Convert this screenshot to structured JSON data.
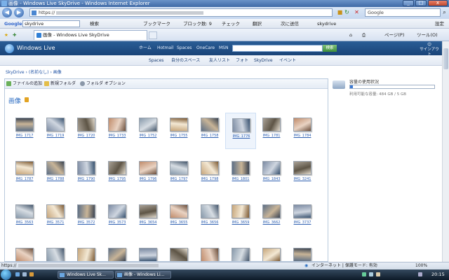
{
  "window": {
    "title": "画像 - Windows Live SkyDrive - Windows Internet Explorer"
  },
  "address": {
    "url_prefix": "https://",
    "search_placeholder": "Google"
  },
  "google_toolbar": {
    "label": "Google",
    "search_value": "skydrive",
    "search_btn": "検索",
    "bookmarks": "ブックマーク",
    "blocked": "ブロック数: 9",
    "check": "チェック",
    "translate": "翻訳",
    "send": "次に送信",
    "skydrive": "skydrive",
    "settings": "設定"
  },
  "tab": {
    "title": "画像 - Windows Live SkyDrive"
  },
  "commandbar": {
    "page": "ページ(P)",
    "tools": "ツール(O)"
  },
  "live_header": {
    "logo": "Windows Live",
    "links": [
      "ホーム",
      "Hotmail",
      "Spaces",
      "OneCare",
      "MSN"
    ],
    "search_btn": "検索",
    "signout": "サインアウト"
  },
  "nav": [
    "Spaces",
    "自分のスペース",
    "友人リスト",
    "フォト",
    "SkyDrive",
    "イベント"
  ],
  "breadcrumb": [
    "SkyDrive",
    "(名前なし)",
    "画像"
  ],
  "toolbar": {
    "add_files": "ファイルの追加",
    "new_folder": "新規フォルダ",
    "folder_options": "フォルダ オプション"
  },
  "page_title": "画像",
  "storage": {
    "title": "容量の使用状況",
    "info": "利用可能な容量: 484 GB / 5 GB",
    "used_fraction": 0.03
  },
  "files": [
    "IMG_1717",
    "IMG_1719",
    "IMG_1720",
    "IMG_1733",
    "IMG_1752",
    "IMG_1755",
    "IMG_1758",
    "IMG_1776",
    "IMG_1781",
    "IMG_1784",
    "IMG_1787",
    "IMG_1788",
    "IMG_1790",
    "IMG_1795",
    "IMG_1796",
    "IMG_1797",
    "IMG_1798",
    "IMG_1801",
    "IMG_1843",
    "IMG_3241",
    "IMG_3563",
    "IMG_3571",
    "IMG_3572",
    "IMG_3573",
    "IMG_3654",
    "IMG_3655",
    "IMG_3656",
    "IMG_3659",
    "IMG_3662",
    "IMG_3737",
    "",
    "",
    "",
    "",
    "",
    "",
    "",
    "",
    "",
    ""
  ],
  "selected_file": "IMG_1776",
  "status": {
    "url_prefix": "https://",
    "zone": "インターネット | 保護モード: 有効",
    "zoom": "100%"
  },
  "taskbar": {
    "items": [
      "Windows Live Sk...",
      "画像 - Windows Li..."
    ],
    "clock": "20:15"
  }
}
